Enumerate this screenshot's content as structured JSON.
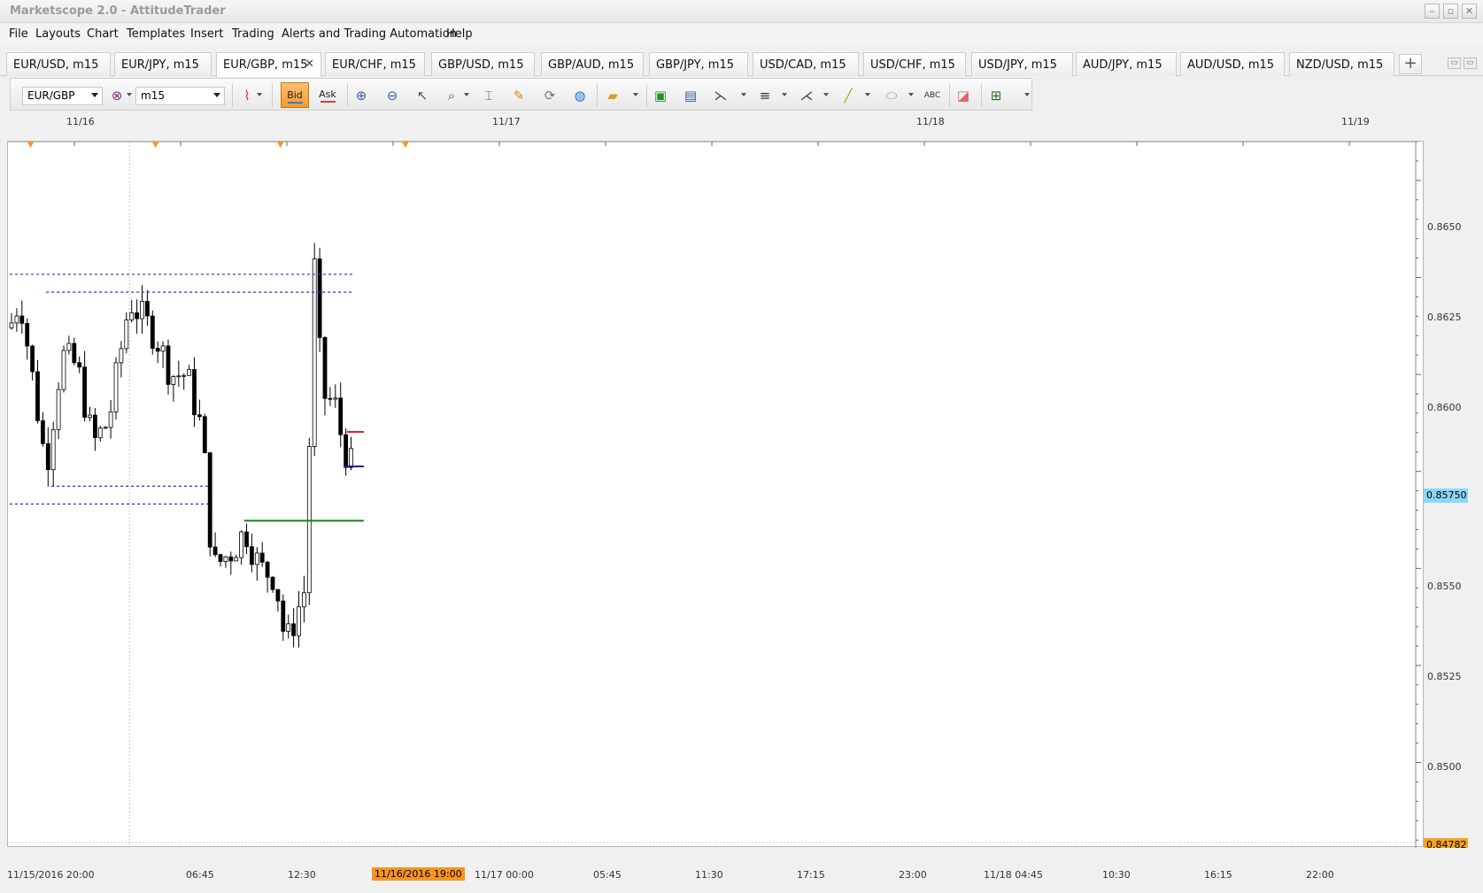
{
  "window": {
    "title": "Marketscope 2.0 - AttitudeTrader",
    "buttons": [
      "minimize",
      "restore",
      "close"
    ]
  },
  "menu": [
    "File",
    "Layouts",
    "Chart",
    "Templates",
    "Insert",
    "Trading",
    "Alerts and Trading Automation",
    "Help"
  ],
  "tabs": [
    {
      "label": "EUR/USD, m15",
      "active": false
    },
    {
      "label": "EUR/JPY, m15",
      "active": false
    },
    {
      "label": "EUR/GBP, m15",
      "active": true
    },
    {
      "label": "EUR/CHF, m15",
      "active": false
    },
    {
      "label": "GBP/USD, m15",
      "active": false
    },
    {
      "label": "GBP/AUD, m15",
      "active": false
    },
    {
      "label": "GBP/JPY, m15",
      "active": false
    },
    {
      "label": "USD/CAD, m15",
      "active": false
    },
    {
      "label": "USD/CHF, m15",
      "active": false
    },
    {
      "label": "USD/JPY, m15",
      "active": false
    },
    {
      "label": "AUD/JPY, m15",
      "active": false
    },
    {
      "label": "AUD/USD, m15",
      "active": false
    },
    {
      "label": "NZD/USD, m15",
      "active": false
    }
  ],
  "tab_close_glyph": "✕",
  "new_tab_glyph": "+",
  "toolbar": {
    "instrument": "EUR/GBP",
    "timeframe": "m15",
    "bid_label": "Bid",
    "ask_label": "Ask"
  },
  "chart": {
    "date_markers": [
      "11/16",
      "11/17",
      "11/18",
      "11/19"
    ],
    "price_labels": [
      "0.8650",
      "0.8625",
      "0.8600",
      "0.8575",
      "0.8550",
      "0.8525",
      "0.8500"
    ],
    "current_price": "0.85750",
    "low_price": "0.84782",
    "time_labels": [
      "11/15/2016 20:00",
      "06:45",
      "12:30",
      "11/16/2016 19:00",
      "11/17 00:00",
      "05:45",
      "11:30",
      "17:15",
      "23:00",
      "11/18 04:45",
      "10:30",
      "16:15",
      "22:00"
    ],
    "highlighted_time": "11/16/2016 19:00",
    "colors": {
      "support_resistance": "#2233cc",
      "green_level": "#118811",
      "red_level": "#e02020",
      "blue_level": "#1a1aa8",
      "current_price_bg": "#8ad6f5",
      "low_price_bg": "#f8a21d"
    }
  },
  "chart_data": {
    "type": "candlestick",
    "instrument": "EUR/GBP",
    "timeframe": "m15",
    "ylim": [
      0.8478,
      0.866
    ],
    "levels": [
      {
        "price": 0.86258,
        "style": "dashed",
        "color": "#2233cc",
        "from": "11/15/2016 20:00",
        "to": "11/18 14:00"
      },
      {
        "price": 0.86212,
        "style": "dashed",
        "color": "#2233cc",
        "from": "11/16 03:00",
        "to": "11/18 14:00"
      },
      {
        "price": 0.85712,
        "style": "dashed",
        "color": "#2233cc",
        "from": "11/16 04:00",
        "to": "11/17 10:30"
      },
      {
        "price": 0.85666,
        "style": "dashed",
        "color": "#2233cc",
        "from": "11/15/2016 20:00",
        "to": "11/17 10:30"
      },
      {
        "price": 0.85623,
        "style": "solid",
        "color": "#118811",
        "from": "11/17 17:00",
        "to": "11/18 16:00"
      },
      {
        "price": 0.85852,
        "style": "solid",
        "color": "#e02020",
        "from": "11/18 12:45",
        "to": "11/18 16:00"
      },
      {
        "price": 0.85763,
        "style": "solid",
        "color": "#1a1aa8",
        "from": "11/18 12:15",
        "to": "11/18 16:00"
      }
    ],
    "path_estimate": [
      {
        "t": "11/15/2016 20:00",
        "price": 0.8612
      },
      {
        "t": "11/15 22:00",
        "price": 0.862
      },
      {
        "t": "11/16 03:00",
        "price": 0.8576
      },
      {
        "t": "11/16 06:00",
        "price": 0.8605
      },
      {
        "t": "11/16 09:00",
        "price": 0.8602
      },
      {
        "t": "11/16 12:00",
        "price": 0.8582
      },
      {
        "t": "11/16 15:00",
        "price": 0.8588
      },
      {
        "t": "11/16 19:00",
        "price": 0.8619
      },
      {
        "t": "11/17 00:00",
        "price": 0.861
      },
      {
        "t": "11/17 03:00",
        "price": 0.86
      },
      {
        "t": "11/17 06:00",
        "price": 0.86
      },
      {
        "t": "11/17 09:00",
        "price": 0.8585
      },
      {
        "t": "11/17 11:00",
        "price": 0.855
      },
      {
        "t": "11/17 15:00",
        "price": 0.8555
      },
      {
        "t": "11/17 17:15",
        "price": 0.856
      },
      {
        "t": "11/17 20:00",
        "price": 0.855
      },
      {
        "t": "11/17 23:00",
        "price": 0.8548
      },
      {
        "t": "11/18 01:00",
        "price": 0.853
      },
      {
        "t": "11/18 04:45",
        "price": 0.8545
      },
      {
        "t": "11/18 06:30",
        "price": 0.8628
      },
      {
        "t": "11/18 08:00",
        "price": 0.8595
      },
      {
        "t": "11/18 10:30",
        "price": 0.8592
      },
      {
        "t": "11/18 12:00",
        "price": 0.8582
      },
      {
        "t": "11/18 14:00",
        "price": 0.8575
      }
    ]
  }
}
